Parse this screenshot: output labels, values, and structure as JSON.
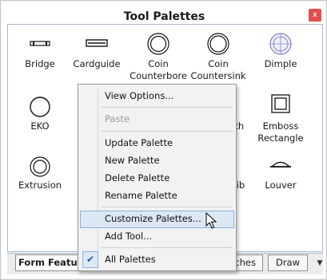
{
  "window": {
    "title": "Tool Palettes",
    "close_glyph": "x"
  },
  "tools": [
    {
      "label": "Bridge",
      "icon": "bridge-icon"
    },
    {
      "label": "Cardguide",
      "icon": "cardguide-icon"
    },
    {
      "label": "Coin\nCounterbore",
      "icon": "coin-counterbore-icon"
    },
    {
      "label": "Coin\nCountersink",
      "icon": "coin-countersink-icon"
    },
    {
      "label": "Dimple",
      "icon": "dimple-icon"
    },
    {
      "label": "EKO",
      "icon": "eko-icon"
    },
    {
      "label": "",
      "icon": "hidden-tool-icon"
    },
    {
      "label": "",
      "icon": "hidden-tool-icon"
    },
    {
      "label": "with",
      "icon": "partial-tool-icon"
    },
    {
      "label": "Emboss\nRectangle",
      "icon": "emboss-rectangle-icon"
    },
    {
      "label": "Extrusion",
      "icon": "extrusion-icon"
    },
    {
      "label": "",
      "icon": "hidden-tool-icon"
    },
    {
      "label": "",
      "icon": "hidden-tool-icon"
    },
    {
      "label": "Rib",
      "icon": "rib-icon"
    },
    {
      "label": "Louver",
      "icon": "louver-icon"
    }
  ],
  "tabs": [
    {
      "label": "Form Features",
      "active": true
    },
    {
      "label": "Punches",
      "active": false
    },
    {
      "label": "Draw",
      "active": false
    }
  ],
  "tab_scroll_glyph": "▼",
  "context_menu": {
    "items": [
      {
        "label": "View Options...",
        "enabled": true
      },
      {
        "label": "Paste",
        "enabled": false
      },
      {
        "label": "Update Palette",
        "enabled": true
      },
      {
        "label": "New Palette",
        "enabled": true
      },
      {
        "label": "Delete Palette",
        "enabled": true
      },
      {
        "label": "Rename Palette",
        "enabled": true
      },
      {
        "label": "Customize Palettes...",
        "enabled": true,
        "highlighted": true
      },
      {
        "label": "Add Tool...",
        "enabled": true
      },
      {
        "label": "All Palettes",
        "enabled": true,
        "checked": true
      }
    ],
    "check_glyph": "✔"
  },
  "colors": {
    "close_button": "#e14f4f",
    "menu_highlight": "#dde8f6",
    "menu_highlight_border": "#8fb2de",
    "disabled_text": "#9a9a9a"
  }
}
